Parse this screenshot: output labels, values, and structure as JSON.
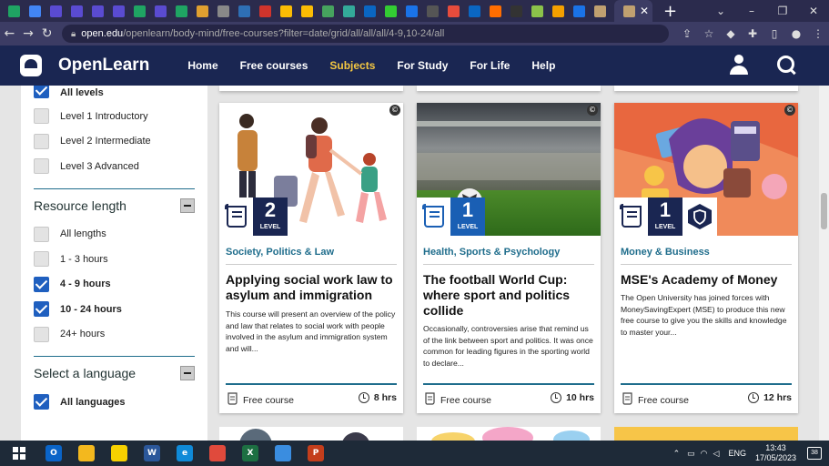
{
  "browser": {
    "tab_favicon_colors": [
      "#1fa463",
      "#4285f4",
      "#5a4bd1",
      "#5a4bd1",
      "#5a4bd1",
      "#5a4bd1",
      "#1fa463",
      "#5a4bd1",
      "#1fa463",
      "#e0a030",
      "#888888",
      "#2e6fb5",
      "#d0342c",
      "#fbbc04",
      "#fbbc04",
      "#46a35e",
      "#3a9",
      "#0a66c2",
      "#3c3",
      "#1a73e8",
      "#555555",
      "#e74c3c",
      "#0a66c2",
      "#ff6d00",
      "#333333",
      "#8bc34a",
      "#f4a000",
      "#1a73e8",
      "#c0a070"
    ],
    "window_controls": [
      "⌄",
      "–",
      "❐",
      "✕"
    ],
    "url_host": "open.edu",
    "url_path": "/openlearn/body-mind/free-courses?filter=date/grid/all/all/all/4-9,10-24/all"
  },
  "header": {
    "brand": "OpenLearn",
    "nav": [
      {
        "label": "Home",
        "active": false
      },
      {
        "label": "Free courses",
        "active": false
      },
      {
        "label": "Subjects",
        "active": true
      },
      {
        "label": "For Study",
        "active": false
      },
      {
        "label": "For Life",
        "active": false
      },
      {
        "label": "Help",
        "active": false
      }
    ]
  },
  "sidebar": {
    "level_options": [
      {
        "label": "All levels",
        "checked": true
      },
      {
        "label": "Level 1 Introductory",
        "checked": false
      },
      {
        "label": "Level 2 Intermediate",
        "checked": false
      },
      {
        "label": "Level 3 Advanced",
        "checked": false
      }
    ],
    "length_heading": "Resource length",
    "length_options": [
      {
        "label": "All lengths",
        "checked": false
      },
      {
        "label": "1 - 3 hours",
        "checked": false
      },
      {
        "label": "4 - 9 hours",
        "checked": true
      },
      {
        "label": "10 - 24 hours",
        "checked": true
      },
      {
        "label": "24+ hours",
        "checked": false
      }
    ],
    "language_heading": "Select a language",
    "language_options": [
      {
        "label": "All languages",
        "checked": true
      }
    ]
  },
  "cards": [
    {
      "level": "2",
      "level_label": "LEVEL",
      "category": "Society, Politics & Law",
      "title": "Applying social work law to asylum and immigration",
      "description": "This course will present an overview of the policy and law that relates to social work with people involved in the asylum and immigration system and will...",
      "type": "Free course",
      "duration": "8 hrs",
      "has_badge": false
    },
    {
      "level": "1",
      "level_label": "LEVEL",
      "category": "Health, Sports & Psychology",
      "title": "The football World Cup: where sport and politics collide",
      "description": "Occasionally, controversies arise that remind us of the link between sport and politics. It was once common for leading figures in the sporting world to declare...",
      "type": "Free course",
      "duration": "10 hrs",
      "has_badge": false
    },
    {
      "level": "1",
      "level_label": "LEVEL",
      "category": "Money & Business",
      "title": "MSE's Academy of Money",
      "description": "The Open University has joined forces with MoneySavingExpert (MSE) to produce this new free course to give you the skills and knowledge to master your...",
      "type": "Free course",
      "duration": "12 hrs",
      "has_badge": true
    }
  ],
  "taskbar": {
    "apps": [
      {
        "icon": "outlook-icon",
        "color": "#0a64c8",
        "letter": "O"
      },
      {
        "icon": "file-explorer-icon",
        "color": "#f3b81e",
        "letter": ""
      },
      {
        "icon": "sticky-notes-icon",
        "color": "#f7d100",
        "letter": ""
      },
      {
        "icon": "word-icon",
        "color": "#2b579a",
        "letter": "W"
      },
      {
        "icon": "edge-icon",
        "color": "#0f8ad8",
        "letter": "e"
      },
      {
        "icon": "chrome-icon",
        "color": "#e04a3c",
        "letter": ""
      },
      {
        "icon": "excel-icon",
        "color": "#1d6f42",
        "letter": "X"
      },
      {
        "icon": "photos-icon",
        "color": "#3a8de0",
        "letter": ""
      },
      {
        "icon": "powerpoint-icon",
        "color": "#c43e1c",
        "letter": "P"
      }
    ],
    "language": "ENG",
    "time": "13:43",
    "date": "17/05/2023",
    "notifications": "38"
  }
}
